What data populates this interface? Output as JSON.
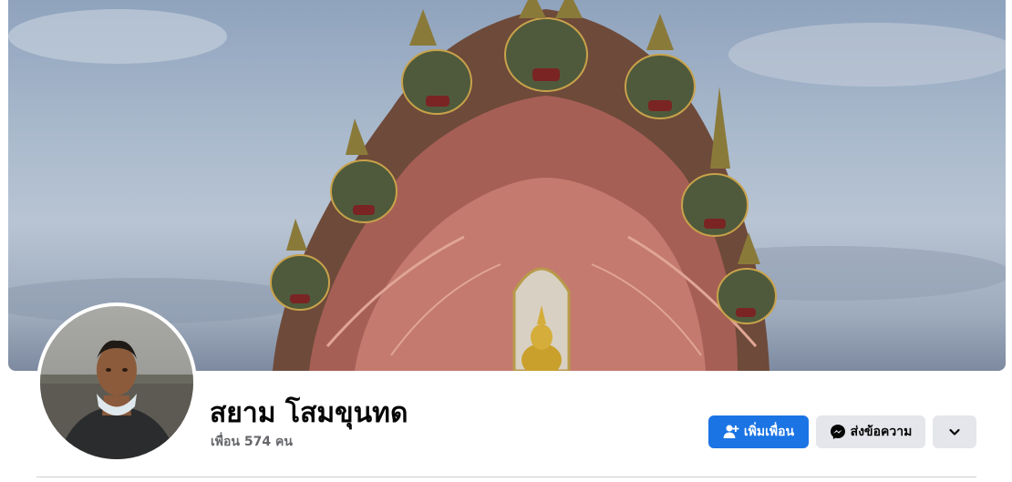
{
  "profile": {
    "name": "สยาม โสมขุนทด",
    "friends_count": "เพื่อน 574 คน"
  },
  "actions": {
    "add_friend_label": "เพิ่มเพื่อน",
    "message_label": "ส่งข้อความ"
  },
  "icons": {
    "add_friend": "user-plus-icon",
    "message": "messenger-icon",
    "more": "chevron-down-icon"
  },
  "colors": {
    "primary": "#1b74e4",
    "secondary_button": "#e4e6eb",
    "text_primary": "#050505",
    "text_secondary": "#65676b"
  }
}
